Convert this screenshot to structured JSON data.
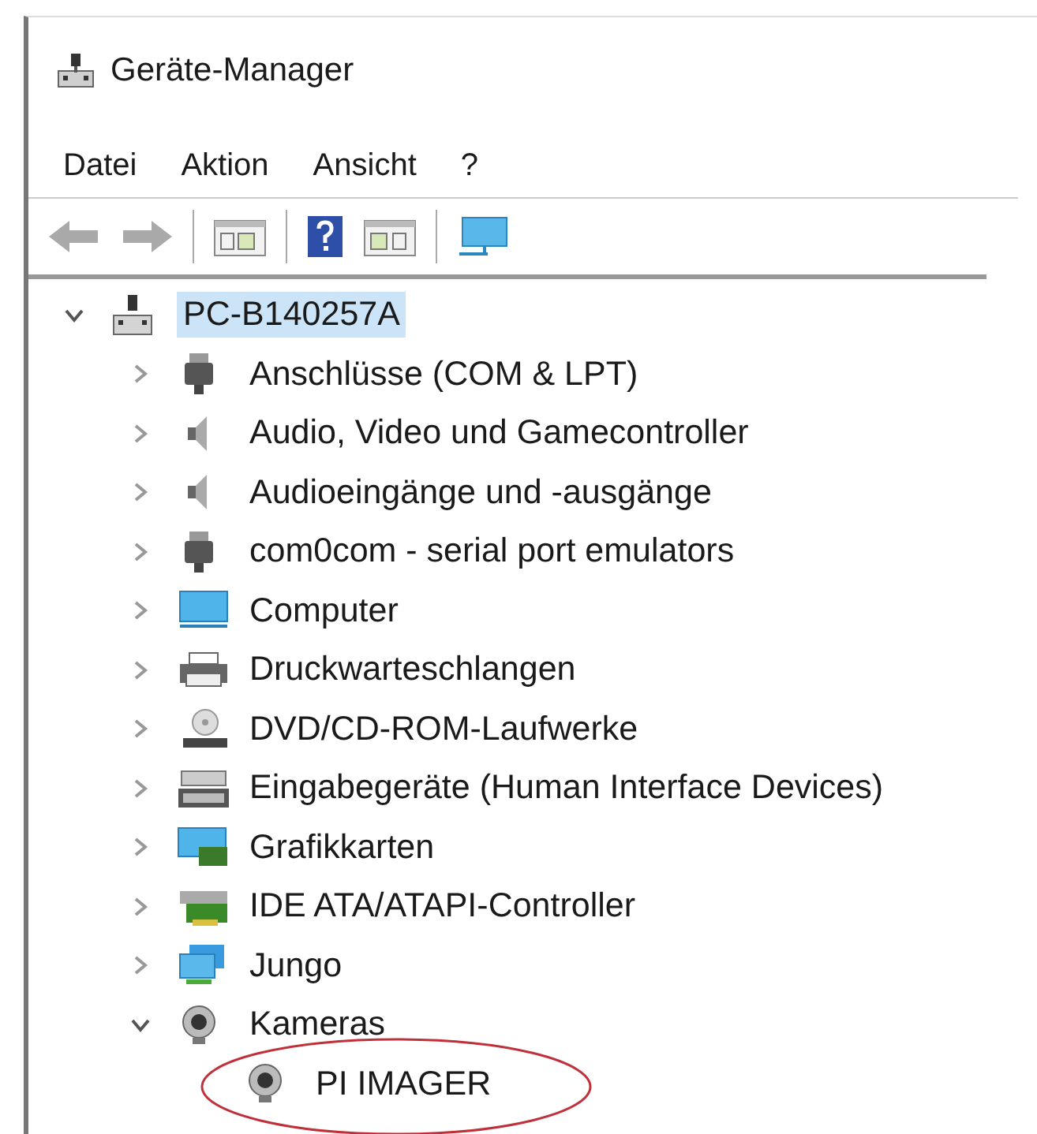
{
  "window": {
    "title": "Geräte-Manager"
  },
  "menu": [
    "Datei",
    "Aktion",
    "Ansicht",
    "?"
  ],
  "toolbar": [
    {
      "kind": "back"
    },
    {
      "kind": "forward"
    },
    {
      "kind": "separator"
    },
    {
      "kind": "properties"
    },
    {
      "kind": "separator"
    },
    {
      "kind": "help"
    },
    {
      "kind": "details"
    },
    {
      "kind": "separator"
    },
    {
      "kind": "scan"
    }
  ],
  "tree": [
    {
      "label": "PC-B140257A",
      "kind": "computer",
      "expanded": true,
      "selected": true,
      "children": [
        {
          "label": "Anschlüsse (COM & LPT)",
          "kind": "port",
          "expanded": false,
          "selected": false
        },
        {
          "label": "Audio, Video und Gamecontroller",
          "kind": "speaker",
          "expanded": false,
          "selected": false
        },
        {
          "label": "Audioeingänge und -ausgänge",
          "kind": "speaker",
          "expanded": false,
          "selected": false
        },
        {
          "label": "com0com - serial port emulators",
          "kind": "port",
          "expanded": false,
          "selected": false
        },
        {
          "label": "Computer",
          "kind": "monitor",
          "expanded": false,
          "selected": false
        },
        {
          "label": "Druckwarteschlangen",
          "kind": "printer",
          "expanded": false,
          "selected": false
        },
        {
          "label": "DVD/CD-ROM-Laufwerke",
          "kind": "disc",
          "expanded": false,
          "selected": false
        },
        {
          "label": "Eingabegeräte (Human Interface Devices)",
          "kind": "keyboard",
          "expanded": false,
          "selected": false
        },
        {
          "label": "Grafikkarten",
          "kind": "display",
          "expanded": false,
          "selected": false
        },
        {
          "label": "IDE ATA/ATAPI-Controller",
          "kind": "card",
          "expanded": false,
          "selected": false
        },
        {
          "label": "Jungo",
          "kind": "network",
          "expanded": false,
          "selected": false
        },
        {
          "label": "Kameras",
          "kind": "camera",
          "expanded": true,
          "selected": false,
          "children": [
            {
              "label": "PI IMAGER",
              "kind": "camera",
              "selected": false,
              "circled": true
            }
          ]
        }
      ]
    }
  ]
}
